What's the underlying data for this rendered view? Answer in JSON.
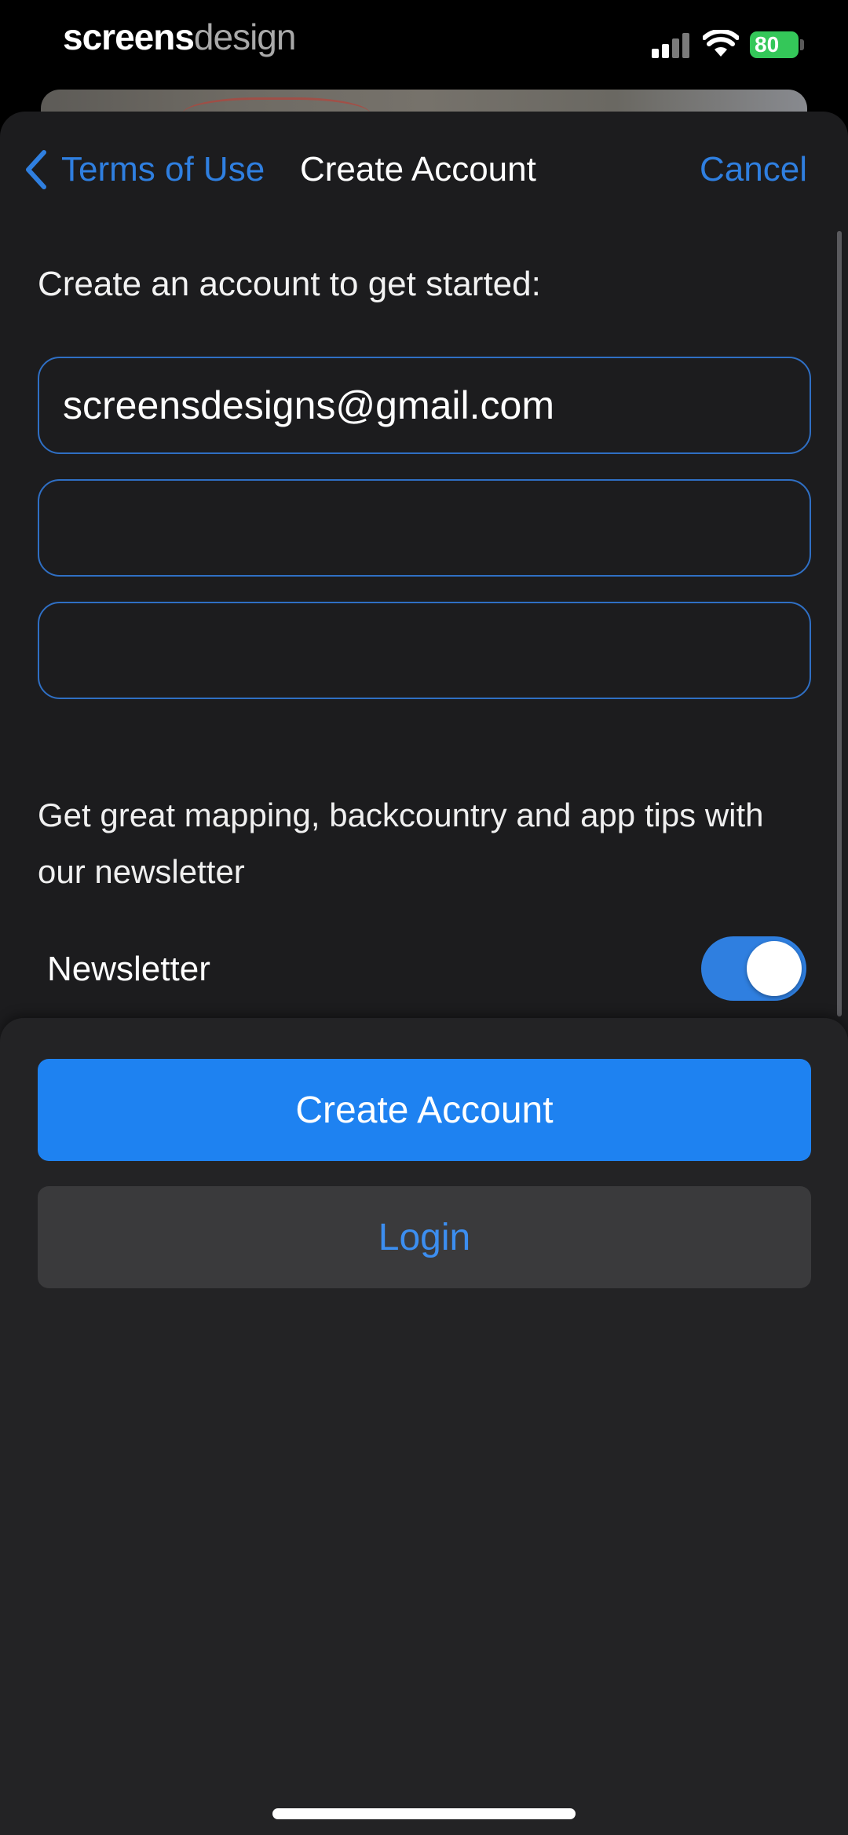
{
  "status_bar": {
    "brand_part1": "screens",
    "brand_part2": "design",
    "battery": "80"
  },
  "nav": {
    "back_label": "Terms of Use",
    "title": "Create Account",
    "cancel_label": "Cancel"
  },
  "form": {
    "intro": "Create an account to get started:",
    "email_value": "screensdesigns@gmail.com",
    "field2_value": "",
    "field3_value": ""
  },
  "newsletter": {
    "description": "Get great mapping, backcountry and app tips with our newsletter",
    "label": "Newsletter",
    "enabled": true
  },
  "actions": {
    "create_label": "Create Account",
    "login_label": "Login"
  },
  "colors": {
    "accent": "#2f7fe0",
    "primary_button": "#1e82f1",
    "sheet_bg": "#1c1c1e",
    "battery": "#34c759"
  }
}
